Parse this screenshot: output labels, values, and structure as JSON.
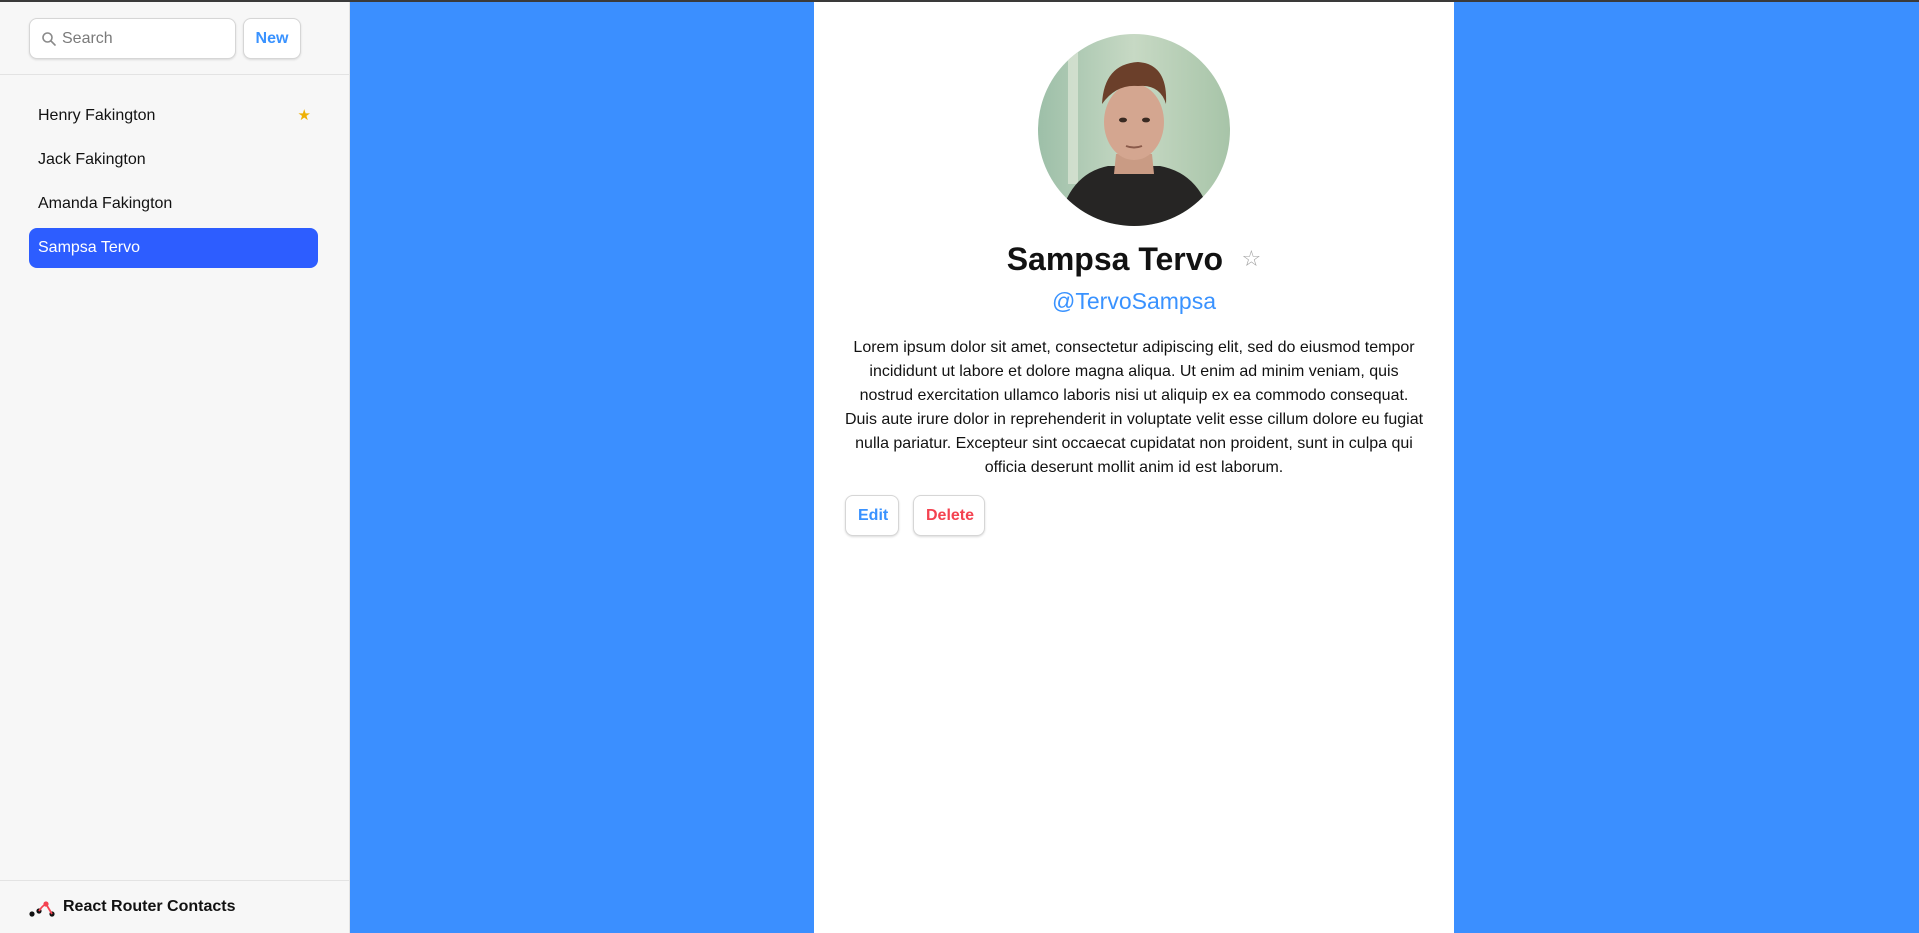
{
  "search": {
    "placeholder": "Search"
  },
  "sidebar": {
    "new_label": "New",
    "contacts": [
      {
        "name": "Henry Fakington",
        "favorite": true,
        "active": false
      },
      {
        "name": "Jack Fakington",
        "favorite": false,
        "active": false
      },
      {
        "name": "Amanda Fakington",
        "favorite": false,
        "active": false
      },
      {
        "name": "Sampsa Tervo",
        "favorite": false,
        "active": true
      }
    ],
    "favorite_star": "★",
    "footer_brand": "React Router Contacts"
  },
  "contact": {
    "name": "Sampsa Tervo",
    "favorite_icon": "☆",
    "twitter": "@TervoSampsa",
    "notes": "Lorem ipsum dolor sit amet, consectetur adipiscing elit, sed do eiusmod tempor incididunt ut labore et dolore magna aliqua. Ut enim ad minim veniam, quis nostrud exercitation ullamco laboris nisi ut aliquip ex ea commodo consequat. Duis aute irure dolor in reprehenderit in voluptate velit esse cillum dolore eu fugiat nulla pariatur. Excepteur sint occaecat cupidatat non proident, sunt in culpa qui officia deserunt mollit anim id est laborum.",
    "edit_label": "Edit",
    "delete_label": "Delete"
  },
  "colors": {
    "accent": "#3992ff",
    "active_item": "#2d5dff",
    "main_background": "#3b8fff",
    "favorite_star": "#eeb004",
    "danger": "#f44250"
  }
}
